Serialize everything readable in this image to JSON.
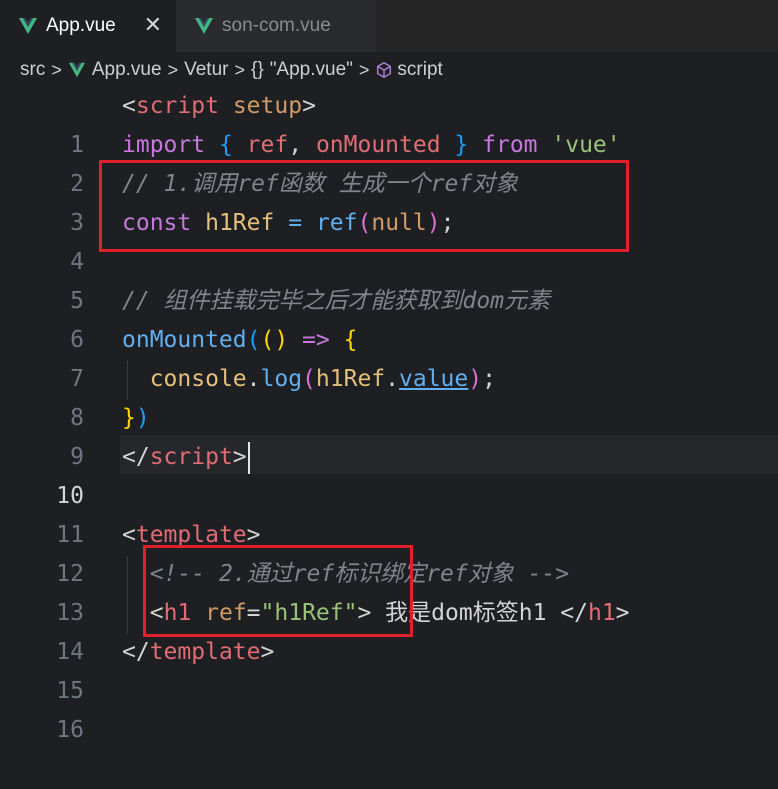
{
  "tabs": [
    {
      "label": "App.vue",
      "close": "✕"
    },
    {
      "label": "son-com.vue"
    }
  ],
  "breadcrumb": {
    "items": [
      "src",
      "App.vue",
      "Vetur",
      "\"App.vue\"",
      "script"
    ],
    "separator": ">",
    "braces": "{}"
  },
  "editor": {
    "line_numbers": [
      "1",
      "2",
      "3",
      "4",
      "5",
      "6",
      "7",
      "8",
      "9",
      "10",
      "11",
      "12",
      "13",
      "14",
      "15",
      "16"
    ],
    "current_line": "10",
    "lines": {
      "l1": {
        "open": "<",
        "tag": "script",
        "sp": " ",
        "attr": "setup",
        "close": ">"
      },
      "l2": {
        "import": "import",
        "lb": "{",
        "ref": "ref",
        "comma": ",",
        "onMounted": "onMounted",
        "rb": "}",
        "from": "from",
        "str": "'vue'"
      },
      "l3": {
        "comment": "// 1.调用ref函数 生成一个ref对象"
      },
      "l4": {
        "const": "const",
        "name": "h1Ref",
        "eq": "=",
        "fn": "ref",
        "lp": "(",
        "null": "null",
        "rp": ")",
        "semi": ";"
      },
      "l6": {
        "comment": "// 组件挂载完毕之后才能获取到dom元素"
      },
      "l7": {
        "fn": "onMounted",
        "lp": "(",
        "args": "()",
        "arrow": "=>",
        "lb": "{"
      },
      "l8": {
        "obj": "console",
        "dot": ".",
        "fn": "log",
        "lp": "(",
        "name": "h1Ref",
        "dot2": ".",
        "prop": "value",
        "rp": ")",
        "semi": ";"
      },
      "l9": {
        "rb": "}",
        "rp": ")"
      },
      "l10": {
        "open": "</",
        "tag": "script",
        "close": ">"
      },
      "l12": {
        "open": "<",
        "tag": "template",
        "close": ">"
      },
      "l13": {
        "comment": "<!-- 2.通过ref标识绑定ref对象 -->"
      },
      "l14": {
        "open": "<",
        "tag": "h1",
        "attr": "ref",
        "eq": "=",
        "str": "\"h1Ref\"",
        "close": ">",
        "text": " 我是dom标签h1 ",
        "endopen": "</",
        "endtag": "h1",
        "endclose": ">"
      },
      "l15": {
        "open": "</",
        "tag": "template",
        "close": ">"
      }
    }
  },
  "colors": {
    "highlight_box": "#e0202a",
    "vue_green": "#41b883",
    "background": "#1e1f22"
  }
}
